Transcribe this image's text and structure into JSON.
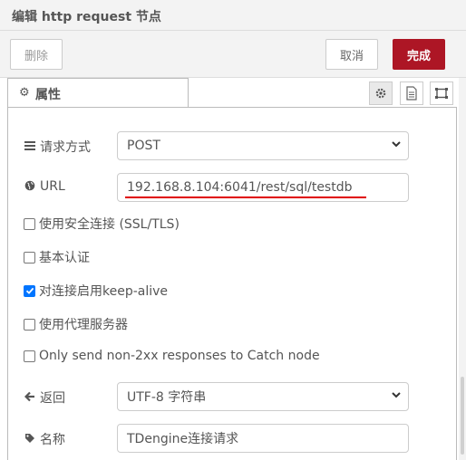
{
  "title": "编辑 http request 节点",
  "toolbar": {
    "delete_label": "删除",
    "cancel_label": "取消",
    "done_label": "完成"
  },
  "tabs": [
    {
      "label": "属性",
      "icon": "gear-icon"
    }
  ],
  "tab_icons": [
    "gear-icon",
    "description-icon",
    "appearance-icon"
  ],
  "form": {
    "method": {
      "label": "请求方式",
      "icon": "list-icon",
      "value": "POST"
    },
    "url": {
      "label": "URL",
      "icon": "globe-icon",
      "value": "192.168.8.104:6041/rest/sql/testdb"
    },
    "checkboxes": [
      {
        "label": "使用安全连接 (SSL/TLS)",
        "checked": false
      },
      {
        "label": "基本认证",
        "checked": false
      },
      {
        "label": "对连接启用keep-alive",
        "checked": true
      },
      {
        "label": "使用代理服务器",
        "checked": false
      },
      {
        "label": "Only send non-2xx responses to Catch node",
        "checked": false
      }
    ],
    "return": {
      "label": "返回",
      "icon": "arrow-left-icon",
      "value": "UTF-8 字符串"
    },
    "name": {
      "label": "名称",
      "icon": "tag-icon",
      "value": "TDengine连接请求"
    }
  },
  "colors": {
    "accent": "#ad1625",
    "check": "#0075ff",
    "annotation": "#e00000"
  }
}
